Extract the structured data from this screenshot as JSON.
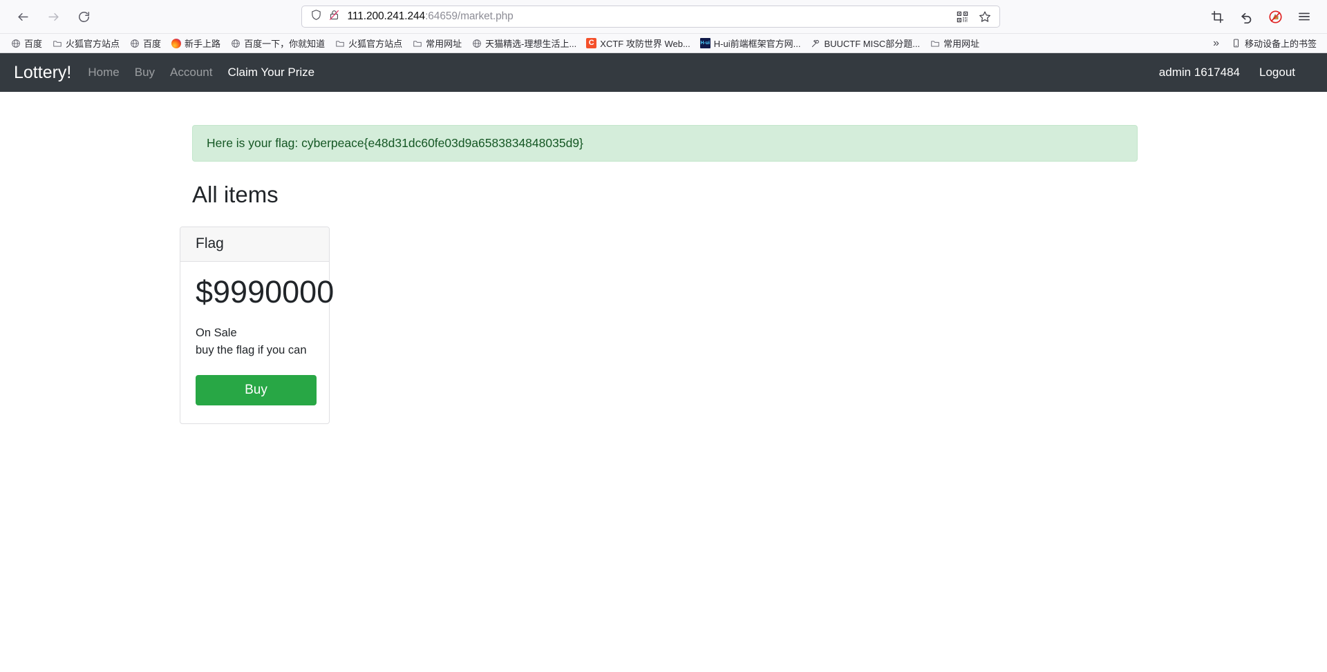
{
  "browser": {
    "back_tooltip": "Back",
    "forward_tooltip": "Forward",
    "reload_tooltip": "Reload",
    "url_host": "111.200.241.244",
    "url_rest": ":64659/market.php",
    "shield_icon": "shield-icon",
    "lock_broken_icon": "insecure-connection-icon",
    "qr_icon": "qr-code-icon",
    "bookmark_star_icon": "bookmark-star-icon",
    "screenshot_icon": "screenshot-crop-icon",
    "undo_icon": "undo-arrow-icon",
    "adblock_icon": "adblock-disabled-icon",
    "menu_icon": "hamburger-menu-icon",
    "overflow_label": "»",
    "mobile_bookmarks_label": "移动设备上的书签",
    "mobile_bookmarks_icon": "mobile-device-icon"
  },
  "bookmarks": [
    {
      "label": "百度",
      "icon": "globe-icon"
    },
    {
      "label": "火狐官方站点",
      "icon": "folder-icon"
    },
    {
      "label": "百度",
      "icon": "globe-icon"
    },
    {
      "label": "新手上路",
      "icon": "firefox-icon"
    },
    {
      "label": "百度一下，你就知道",
      "icon": "globe-icon"
    },
    {
      "label": "火狐官方站点",
      "icon": "folder-icon"
    },
    {
      "label": "常用网址",
      "icon": "folder-icon"
    },
    {
      "label": "天猫精选-理想生活上...",
      "icon": "globe-icon"
    },
    {
      "label": "XCTF 攻防世界 Web...",
      "icon": "ctf-c-icon"
    },
    {
      "label": "H-ui前端框架官方网...",
      "icon": "hui-icon"
    },
    {
      "label": "BUUCTF MISC部分题...",
      "icon": "buuctf-icon"
    },
    {
      "label": "常用网址",
      "icon": "folder-icon"
    }
  ],
  "page": {
    "navbar": {
      "brand": "Lottery!",
      "links": [
        {
          "label": "Home",
          "active": false
        },
        {
          "label": "Buy",
          "active": false
        },
        {
          "label": "Account",
          "active": false
        },
        {
          "label": "Claim Your Prize",
          "active": true
        }
      ],
      "user": "admin 1617484",
      "logout": "Logout",
      "bg_color": "#343a40"
    },
    "alert": {
      "text": "Here is your flag: cyberpeace{e48d31dc60fe03d9a6583834848035d9}",
      "bg_color": "#d4edda",
      "border_color": "#c3e6cb",
      "text_color": "#155724"
    },
    "section_title": "All items",
    "card": {
      "header": "Flag",
      "price": "$9990000",
      "status": "On Sale",
      "description": "buy the flag if you can",
      "buy_label": "Buy",
      "buy_color": "#28a745"
    }
  }
}
